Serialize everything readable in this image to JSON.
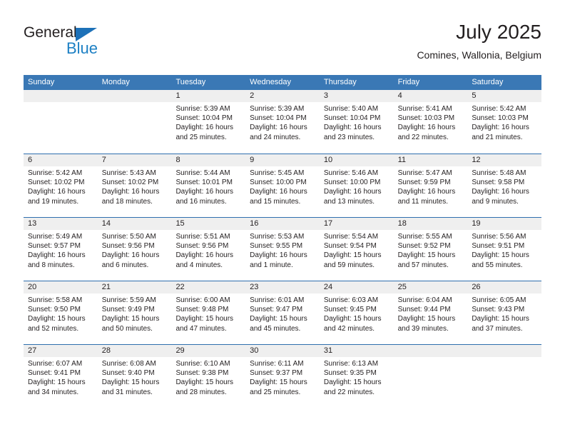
{
  "brand": {
    "name_top": "General",
    "name_bottom": "Blue"
  },
  "header": {
    "title": "July 2025",
    "location": "Comines, Wallonia, Belgium"
  },
  "colors": {
    "header_blue": "#3a78b5",
    "week_divider_blue": "#2f6fae",
    "daynum_band": "#efefef",
    "brand_blue": "#1d80c4",
    "text": "#231f20"
  },
  "weekdays": [
    "Sunday",
    "Monday",
    "Tuesday",
    "Wednesday",
    "Thursday",
    "Friday",
    "Saturday"
  ],
  "weeks": [
    [
      {
        "day": "",
        "sunrise": "",
        "sunset": "",
        "daylight": ""
      },
      {
        "day": "",
        "sunrise": "",
        "sunset": "",
        "daylight": ""
      },
      {
        "day": "1",
        "sunrise": "Sunrise: 5:39 AM",
        "sunset": "Sunset: 10:04 PM",
        "daylight": "Daylight: 16 hours and 25 minutes."
      },
      {
        "day": "2",
        "sunrise": "Sunrise: 5:39 AM",
        "sunset": "Sunset: 10:04 PM",
        "daylight": "Daylight: 16 hours and 24 minutes."
      },
      {
        "day": "3",
        "sunrise": "Sunrise: 5:40 AM",
        "sunset": "Sunset: 10:04 PM",
        "daylight": "Daylight: 16 hours and 23 minutes."
      },
      {
        "day": "4",
        "sunrise": "Sunrise: 5:41 AM",
        "sunset": "Sunset: 10:03 PM",
        "daylight": "Daylight: 16 hours and 22 minutes."
      },
      {
        "day": "5",
        "sunrise": "Sunrise: 5:42 AM",
        "sunset": "Sunset: 10:03 PM",
        "daylight": "Daylight: 16 hours and 21 minutes."
      }
    ],
    [
      {
        "day": "6",
        "sunrise": "Sunrise: 5:42 AM",
        "sunset": "Sunset: 10:02 PM",
        "daylight": "Daylight: 16 hours and 19 minutes."
      },
      {
        "day": "7",
        "sunrise": "Sunrise: 5:43 AM",
        "sunset": "Sunset: 10:02 PM",
        "daylight": "Daylight: 16 hours and 18 minutes."
      },
      {
        "day": "8",
        "sunrise": "Sunrise: 5:44 AM",
        "sunset": "Sunset: 10:01 PM",
        "daylight": "Daylight: 16 hours and 16 minutes."
      },
      {
        "day": "9",
        "sunrise": "Sunrise: 5:45 AM",
        "sunset": "Sunset: 10:00 PM",
        "daylight": "Daylight: 16 hours and 15 minutes."
      },
      {
        "day": "10",
        "sunrise": "Sunrise: 5:46 AM",
        "sunset": "Sunset: 10:00 PM",
        "daylight": "Daylight: 16 hours and 13 minutes."
      },
      {
        "day": "11",
        "sunrise": "Sunrise: 5:47 AM",
        "sunset": "Sunset: 9:59 PM",
        "daylight": "Daylight: 16 hours and 11 minutes."
      },
      {
        "day": "12",
        "sunrise": "Sunrise: 5:48 AM",
        "sunset": "Sunset: 9:58 PM",
        "daylight": "Daylight: 16 hours and 9 minutes."
      }
    ],
    [
      {
        "day": "13",
        "sunrise": "Sunrise: 5:49 AM",
        "sunset": "Sunset: 9:57 PM",
        "daylight": "Daylight: 16 hours and 8 minutes."
      },
      {
        "day": "14",
        "sunrise": "Sunrise: 5:50 AM",
        "sunset": "Sunset: 9:56 PM",
        "daylight": "Daylight: 16 hours and 6 minutes."
      },
      {
        "day": "15",
        "sunrise": "Sunrise: 5:51 AM",
        "sunset": "Sunset: 9:56 PM",
        "daylight": "Daylight: 16 hours and 4 minutes."
      },
      {
        "day": "16",
        "sunrise": "Sunrise: 5:53 AM",
        "sunset": "Sunset: 9:55 PM",
        "daylight": "Daylight: 16 hours and 1 minute."
      },
      {
        "day": "17",
        "sunrise": "Sunrise: 5:54 AM",
        "sunset": "Sunset: 9:54 PM",
        "daylight": "Daylight: 15 hours and 59 minutes."
      },
      {
        "day": "18",
        "sunrise": "Sunrise: 5:55 AM",
        "sunset": "Sunset: 9:52 PM",
        "daylight": "Daylight: 15 hours and 57 minutes."
      },
      {
        "day": "19",
        "sunrise": "Sunrise: 5:56 AM",
        "sunset": "Sunset: 9:51 PM",
        "daylight": "Daylight: 15 hours and 55 minutes."
      }
    ],
    [
      {
        "day": "20",
        "sunrise": "Sunrise: 5:58 AM",
        "sunset": "Sunset: 9:50 PM",
        "daylight": "Daylight: 15 hours and 52 minutes."
      },
      {
        "day": "21",
        "sunrise": "Sunrise: 5:59 AM",
        "sunset": "Sunset: 9:49 PM",
        "daylight": "Daylight: 15 hours and 50 minutes."
      },
      {
        "day": "22",
        "sunrise": "Sunrise: 6:00 AM",
        "sunset": "Sunset: 9:48 PM",
        "daylight": "Daylight: 15 hours and 47 minutes."
      },
      {
        "day": "23",
        "sunrise": "Sunrise: 6:01 AM",
        "sunset": "Sunset: 9:47 PM",
        "daylight": "Daylight: 15 hours and 45 minutes."
      },
      {
        "day": "24",
        "sunrise": "Sunrise: 6:03 AM",
        "sunset": "Sunset: 9:45 PM",
        "daylight": "Daylight: 15 hours and 42 minutes."
      },
      {
        "day": "25",
        "sunrise": "Sunrise: 6:04 AM",
        "sunset": "Sunset: 9:44 PM",
        "daylight": "Daylight: 15 hours and 39 minutes."
      },
      {
        "day": "26",
        "sunrise": "Sunrise: 6:05 AM",
        "sunset": "Sunset: 9:43 PM",
        "daylight": "Daylight: 15 hours and 37 minutes."
      }
    ],
    [
      {
        "day": "27",
        "sunrise": "Sunrise: 6:07 AM",
        "sunset": "Sunset: 9:41 PM",
        "daylight": "Daylight: 15 hours and 34 minutes."
      },
      {
        "day": "28",
        "sunrise": "Sunrise: 6:08 AM",
        "sunset": "Sunset: 9:40 PM",
        "daylight": "Daylight: 15 hours and 31 minutes."
      },
      {
        "day": "29",
        "sunrise": "Sunrise: 6:10 AM",
        "sunset": "Sunset: 9:38 PM",
        "daylight": "Daylight: 15 hours and 28 minutes."
      },
      {
        "day": "30",
        "sunrise": "Sunrise: 6:11 AM",
        "sunset": "Sunset: 9:37 PM",
        "daylight": "Daylight: 15 hours and 25 minutes."
      },
      {
        "day": "31",
        "sunrise": "Sunrise: 6:13 AM",
        "sunset": "Sunset: 9:35 PM",
        "daylight": "Daylight: 15 hours and 22 minutes."
      },
      {
        "day": "",
        "sunrise": "",
        "sunset": "",
        "daylight": ""
      },
      {
        "day": "",
        "sunrise": "",
        "sunset": "",
        "daylight": ""
      }
    ]
  ]
}
